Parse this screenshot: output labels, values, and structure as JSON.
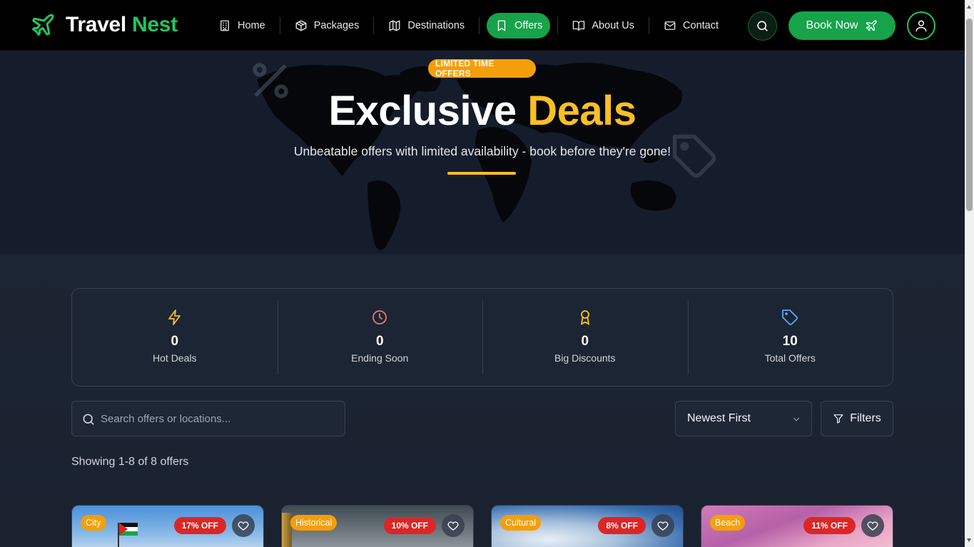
{
  "brand": {
    "name_part1": "Travel",
    "name_part2": "Nest",
    "icon": "plane-icon"
  },
  "nav": {
    "items": [
      {
        "label": "Home",
        "icon": "building-icon"
      },
      {
        "label": "Packages",
        "icon": "package-icon"
      },
      {
        "label": "Destinations",
        "icon": "map-icon"
      },
      {
        "label": "Offers",
        "icon": "bookmark-icon",
        "active": true
      },
      {
        "label": "About Us",
        "icon": "book-open-icon"
      },
      {
        "label": "Contact",
        "icon": "mail-icon"
      }
    ],
    "book_label": "Book Now"
  },
  "hero": {
    "badge": "LIMITED TIME OFFERS",
    "title_main": "Exclusive",
    "title_accent": "Deals",
    "subtitle": "Unbeatable offers with limited availability - book before they're gone!"
  },
  "stats": [
    {
      "value": "0",
      "label": "Hot Deals",
      "icon": "lightning-icon",
      "color": "#fbbf24"
    },
    {
      "value": "0",
      "label": "Ending Soon",
      "icon": "clock-icon",
      "color": "#f87171"
    },
    {
      "value": "0",
      "label": "Big Discounts",
      "icon": "award-icon",
      "color": "#facc15"
    },
    {
      "value": "10",
      "label": "Total Offers",
      "icon": "tag-icon",
      "color": "#60a5fa"
    }
  ],
  "search": {
    "placeholder": "Search offers or locations...",
    "value": ""
  },
  "sort": {
    "selected": "Newest First"
  },
  "filters_label": "Filters",
  "showing_text": "Showing 1-8 of 8 offers",
  "offers": [
    {
      "category": "City",
      "discount": "17% OFF"
    },
    {
      "category": "Historical",
      "discount": "10% OFF"
    },
    {
      "category": "Cultural",
      "discount": "8% OFF"
    },
    {
      "category": "Beach",
      "discount": "11% OFF"
    }
  ],
  "colors": {
    "brand_green": "#16a34a",
    "accent_yellow": "#fbbf24",
    "badge_orange": "#f59e0b",
    "discount_red": "#dc2626"
  }
}
